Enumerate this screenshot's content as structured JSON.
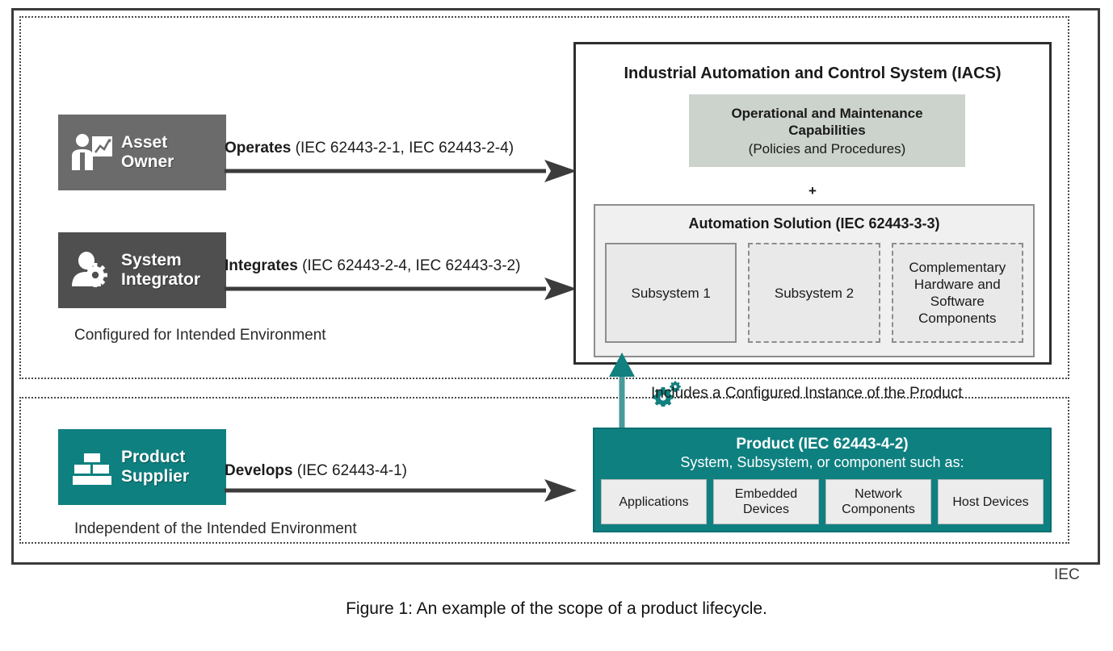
{
  "figure": {
    "caption": "Figure 1: An example of the scope of a product lifecycle.",
    "iec_mark": "IEC"
  },
  "colors": {
    "teal": "#0f8080",
    "asset_owner_gray": "#6b6b6b",
    "system_integrator_gray": "#4f4f4f",
    "om_capabilities_sage": "#ccd2cc",
    "automation_solution_bg": "#f0f0f0",
    "frame_dark": "#3b3b3b"
  },
  "scopes": [
    {
      "id": "configured",
      "caption": "Configured for Intended Environment"
    },
    {
      "id": "independent",
      "caption": "Independent of the Intended Environment"
    }
  ],
  "roles": [
    {
      "id": "asset-owner",
      "label": "Asset\nOwner",
      "icon": "person-with-chart-icon"
    },
    {
      "id": "system-integrator",
      "label": "System\nIntegrator",
      "icon": "person-with-gear-icon"
    },
    {
      "id": "product-supplier",
      "label": "Product\nSupplier",
      "icon": "brick-stack-icon"
    }
  ],
  "arrows": [
    {
      "id": "operates",
      "verb": "Operates",
      "refs": "(IEC 62443-2-1, IEC 62443-2-4)"
    },
    {
      "id": "integrates",
      "verb": "Integrates",
      "refs": "(IEC 62443-2-4, IEC 62443-3-2)"
    },
    {
      "id": "develops",
      "verb": "Develops",
      "refs": "(IEC 62443-4-1)"
    }
  ],
  "iacs": {
    "title": "Industrial Automation and Control System (IACS)",
    "om_capabilities": {
      "title": "Operational and Maintenance\nCapabilities",
      "subtitle": "(Policies and Procedures)"
    },
    "plus": "+",
    "automation_solution": {
      "title": "Automation Solution (IEC 62443-3-3)",
      "cells": [
        {
          "label": "Subsystem 1",
          "border": "solid"
        },
        {
          "label": "Subsystem 2",
          "border": "dashed"
        },
        {
          "label": "Complementary\nHardware and\nSoftware\nComponents",
          "border": "dashed"
        }
      ]
    }
  },
  "includes_note": {
    "text": "Includes a Configured Instance of the Product",
    "icon": "gear-cluster-icon",
    "arrow_icon": "teal-up-arrow-icon"
  },
  "product": {
    "title": "Product (IEC 62443-4-2)",
    "subtitle": "System, Subsystem, or component such as:",
    "cells": [
      {
        "label": "Applications"
      },
      {
        "label": "Embedded\nDevices"
      },
      {
        "label": "Network\nComponents"
      },
      {
        "label": "Host Devices"
      }
    ]
  }
}
